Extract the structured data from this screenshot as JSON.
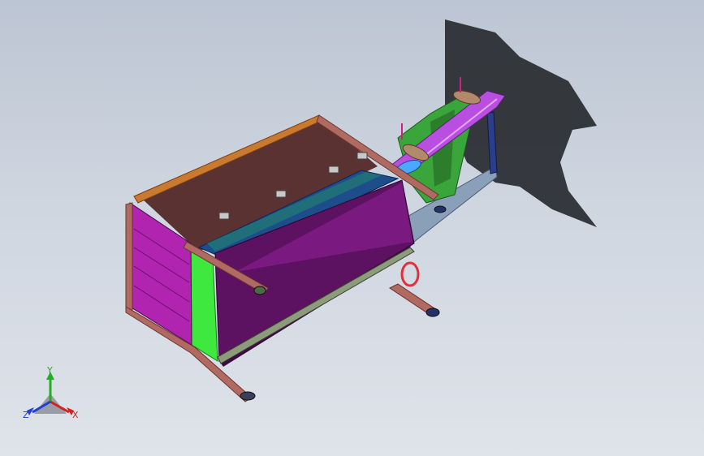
{
  "viewport": {
    "background_top": "#bcc5d3",
    "background_bottom": "#dfe3ea"
  },
  "model": {
    "colors": {
      "frame": "#b06a62",
      "frame_dark": "#7e4a45",
      "top_rail": "#c97a30",
      "magenta_panel": "#b024b0",
      "green_panel": "#3ee83e",
      "purple_hopper": "#5c1260",
      "purple_hopper_light": "#7a1a80",
      "brown_floor": "#5a3232",
      "blue_channel": "#1d4d8a",
      "teal_channel": "#1f6e7a",
      "violet_arm": "#b84fe0",
      "green_mechanism": "#3aa53a",
      "navy_post": "#2a3e8c",
      "red_loop": "#e0303a",
      "shadow": "#2c2f35"
    }
  },
  "triad": {
    "x_label": "X",
    "y_label": "Y",
    "z_label": "Z",
    "x_color": "#d42020",
    "y_color": "#20b020",
    "z_color": "#2040d0"
  }
}
